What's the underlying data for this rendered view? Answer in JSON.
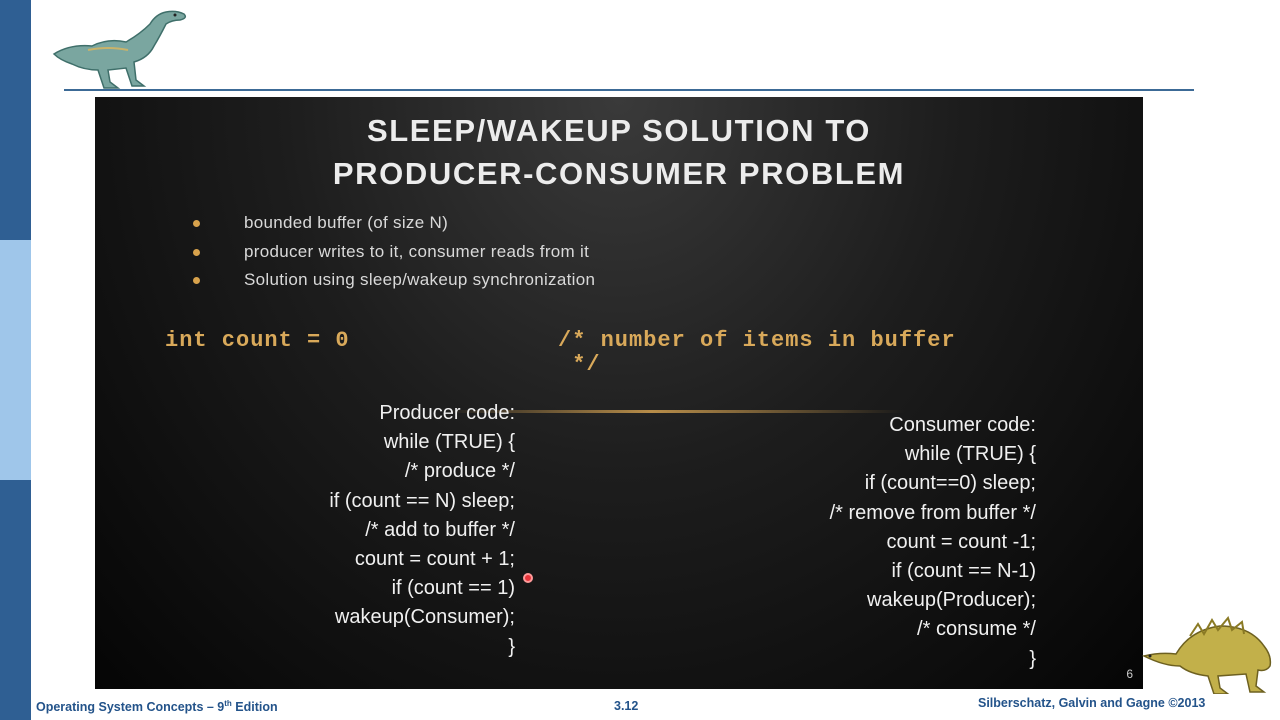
{
  "slide": {
    "title_line1": "SLEEP/WAKEUP SOLUTION TO",
    "title_line2": "PRODUCER-CONSUMER PROBLEM",
    "bullets": [
      "bounded buffer (of size N)",
      "producer writes to it, consumer reads from it",
      "Solution using sleep/wakeup synchronization"
    ],
    "code_declaration": "int count = 0",
    "code_comment_line1": "/* number of items in buffer",
    "code_comment_line2": " */",
    "producer_lines": [
      "Producer code:",
      "while (TRUE) {",
      "/* produce */",
      "if (count == N) sleep;",
      "/* add to buffer */",
      "count = count + 1;",
      "if (count == 1)",
      "wakeup(Consumer);",
      "}"
    ],
    "consumer_lines": [
      "Consumer code:",
      "while (TRUE) {",
      "if (count==0) sleep;",
      "/* remove from buffer */",
      "count = count -1;",
      "if (count == N-1)",
      "wakeup(Producer);",
      "/* consume */",
      "}"
    ],
    "page_number": "6"
  },
  "footer": {
    "book_title": "Operating System Concepts – 9",
    "edition_sup": "th",
    "edition_suffix": " Edition",
    "page": "3.12",
    "authors": "Silberschatz, Galvin and Gagne ©2013"
  },
  "colors": {
    "frame_blue": "#2f5f93",
    "frame_light_blue": "#9fc6ea",
    "code_gold": "#d9a95a",
    "bullet_dot": "#d8a24c"
  }
}
